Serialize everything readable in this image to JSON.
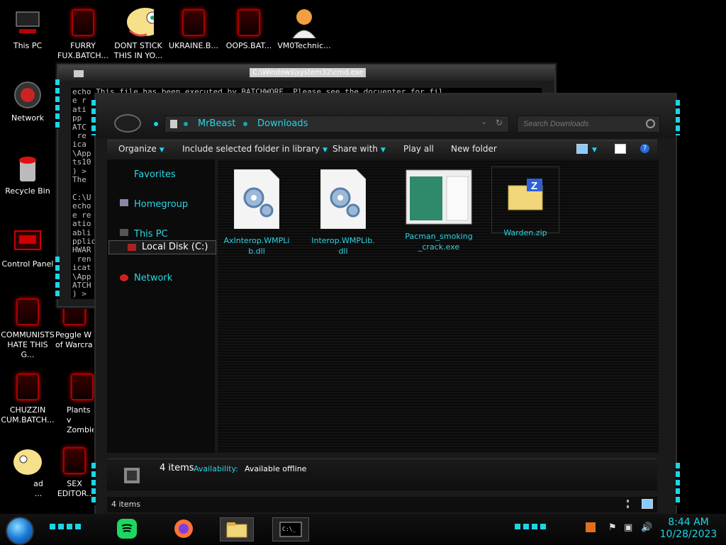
{
  "desktop": {
    "icons": [
      {
        "label": "This PC"
      },
      {
        "label": "FURRY\nFUX.BATCH..."
      },
      {
        "label": "DONT STICK\nTHIS IN YO..."
      },
      {
        "label": "UKRAINE.B..."
      },
      {
        "label": "OOPS.BAT..."
      },
      {
        "label": "VM0Technic..."
      },
      {
        "label": "Network"
      },
      {
        "label": "Recycle Bin"
      },
      {
        "label": "Control Panel"
      },
      {
        "label": "COMMUNISTS\nHATE THIS G..."
      },
      {
        "label": "Peggle W\nof Warcra"
      },
      {
        "label": "CHUZZIN\nCUM.BATCH..."
      },
      {
        "label": "Plants v\nZombies.l"
      },
      {
        "label": "ad\n..."
      },
      {
        "label": "SEX\nEDITOR.."
      }
    ]
  },
  "cmd": {
    "title": "C:\\Windows\\system32\\cmd.exe",
    "text": "echo This file has been executed by BATCHWORE. Please see the docuenter for fil\ne r\nati\npp\nATC\n re\nica\n\\App\nts10\n) >\nThe\n\nC:\\U\necho\ne re\natio\nabli\npplic\nHWAR\n ren\nicat\n\\App\nATCH\n) >"
  },
  "explorer": {
    "breadcrumb": [
      "MrBeast",
      "Downloads"
    ],
    "search_placeholder": "Search Downloads",
    "toolbar": {
      "organize": "Organize",
      "include": "Include selected folder in library",
      "share": "Share with",
      "play": "Play all",
      "new_folder": "New folder"
    },
    "nav": {
      "favorites": "Favorites",
      "homegroup": "Homegroup",
      "this_pc": "This PC",
      "local_disk": "Local Disk (C:)",
      "network": "Network"
    },
    "files": [
      {
        "name": "AxInterop.WMPLib.dll",
        "icon": "dll-gear-icon"
      },
      {
        "name": "Interop.WMPLib.dll",
        "icon": "dll-gear-icon"
      },
      {
        "name": "Pacman_smoking_crack.exe",
        "icon": "exe-window-icon"
      },
      {
        "name": "Warden.zip",
        "icon": "zip-folder-icon"
      }
    ],
    "details": {
      "count": "4 items",
      "availability_label": "Availability:",
      "availability_value": "Available offline"
    },
    "status_count": "4 items"
  },
  "taskbar": {
    "time": "8:44 AM",
    "date": "10/28/2023"
  },
  "colors": {
    "accent": "#1ad6e6",
    "bg": "#000000"
  }
}
